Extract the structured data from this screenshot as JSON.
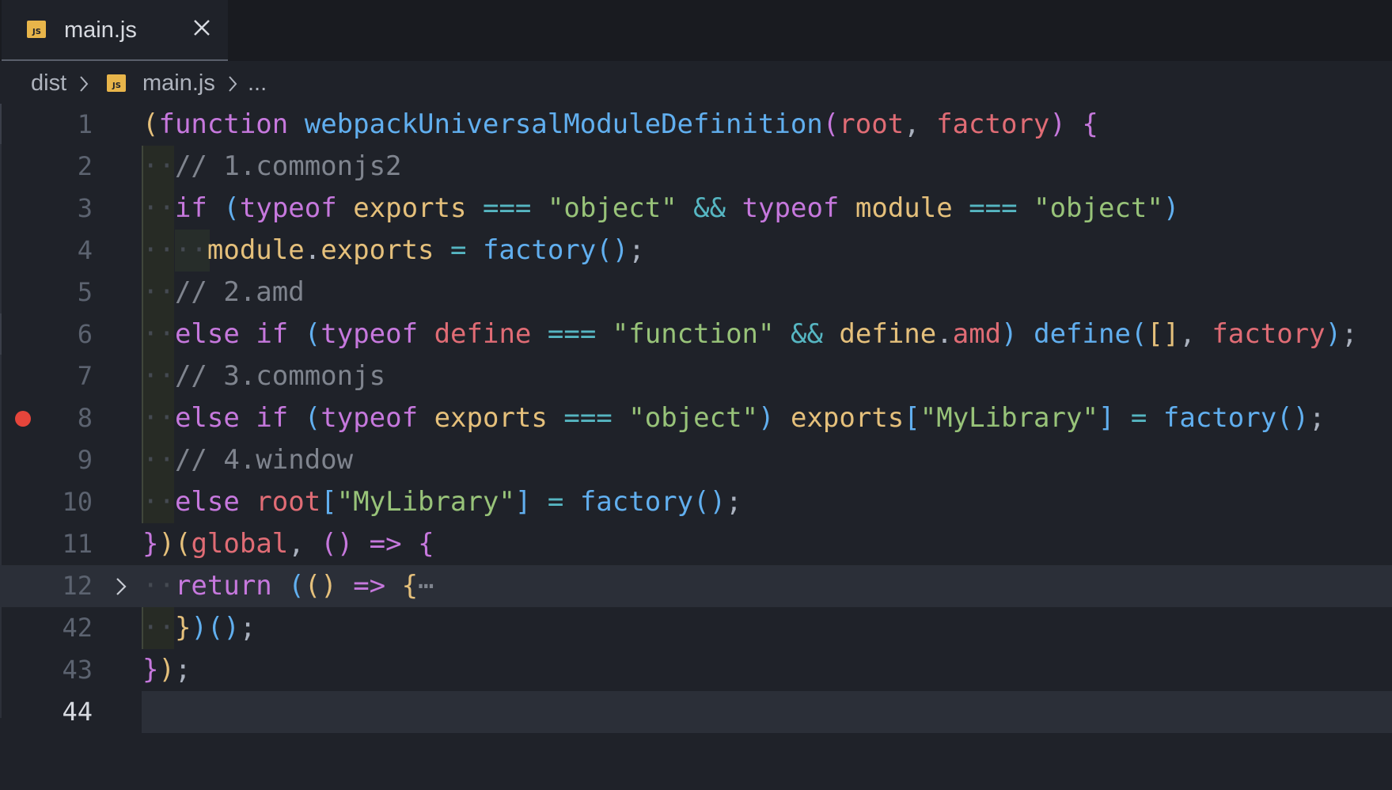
{
  "tab": {
    "label": "main.js",
    "icon": "js-file-icon",
    "icon_text": "JS",
    "close_icon": "close-icon"
  },
  "breadcrumb": {
    "folder": "dist",
    "file": "main.js",
    "more": "..."
  },
  "colors": {
    "background": "#1f2229",
    "tabbar": "#191b20",
    "breakpoint": "#e5453b",
    "js_icon": "#e8b54a"
  },
  "editor": {
    "current_line": "44",
    "breakpoint_line": "8",
    "folded_line": "12",
    "fold_placeholder": "⋯",
    "lines": [
      {
        "num": "1"
      },
      {
        "num": "2"
      },
      {
        "num": "3"
      },
      {
        "num": "4"
      },
      {
        "num": "5"
      },
      {
        "num": "6"
      },
      {
        "num": "7"
      },
      {
        "num": "8"
      },
      {
        "num": "9"
      },
      {
        "num": "10"
      },
      {
        "num": "11"
      },
      {
        "num": "12"
      },
      {
        "num": "42"
      },
      {
        "num": "43"
      },
      {
        "num": "44"
      }
    ],
    "code": {
      "l1": {
        "open_paren": "(",
        "kw_function": "function",
        "name": "webpackUniversalModuleDefinition",
        "p_open": "(",
        "root": "root",
        "comma": ", ",
        "factory": "factory",
        "p_close": ")",
        "brace": "{"
      },
      "l2": {
        "comment": "// 1.commonjs2"
      },
      "l3": {
        "kw_if": "if",
        "p_open": "(",
        "typeof1": "typeof",
        "exports": "exports",
        "eq1": "===",
        "str1": "\"object\"",
        "and": "&&",
        "typeof2": "typeof",
        "module": "module",
        "eq2": "===",
        "str2": "\"object\"",
        "p_close": ")"
      },
      "l4": {
        "module": "module",
        "dot": ".",
        "exports": "exports",
        "assign": "=",
        "factory": "factory",
        "call": "()",
        "semi": ";"
      },
      "l5": {
        "comment": "// 2.amd"
      },
      "l6": {
        "kw_else": "else",
        "kw_if": "if",
        "p_open": "(",
        "typeof": "typeof",
        "define": "define",
        "eq": "===",
        "str": "\"function\"",
        "and": "&&",
        "define2": "define",
        "dot": ".",
        "amd": "amd",
        "p_close": ")",
        "define_call": "define",
        "c_open": "(",
        "arr": "[]",
        "comma": ", ",
        "factory": "factory",
        "c_close": ")",
        "semi": ";"
      },
      "l7": {
        "comment": "// 3.commonjs"
      },
      "l8": {
        "kw_else": "else",
        "kw_if": "if",
        "p_open": "(",
        "typeof": "typeof",
        "exports": "exports",
        "eq": "===",
        "str": "\"object\"",
        "p_close": ")",
        "exports2": "exports",
        "b_open": "[",
        "key": "\"MyLibrary\"",
        "b_close": "]",
        "assign": "=",
        "factory": "factory",
        "call": "()",
        "semi": ";"
      },
      "l9": {
        "comment": "// 4.window"
      },
      "l10": {
        "kw_else": "else",
        "root": "root",
        "b_open": "[",
        "key": "\"MyLibrary\"",
        "b_close": "]",
        "assign": "=",
        "factory": "factory",
        "call": "()",
        "semi": ";"
      },
      "l11": {
        "brace_close": "}",
        "paren_close": ")",
        "p_open": "(",
        "global": "global",
        "comma": ", ",
        "arrow_params": "()",
        "arrow": "=>",
        "brace": "{"
      },
      "l12": {
        "kw_return": "return",
        "p1": "(",
        "p2": "()",
        "arrow": "=>",
        "brace": "{"
      },
      "l42": {
        "brace_close": "}",
        "paren_close": ")",
        "call": "()",
        "semi": ";"
      },
      "l43": {
        "brace_close": "}",
        "paren_close": ")",
        "semi": ";"
      }
    }
  }
}
